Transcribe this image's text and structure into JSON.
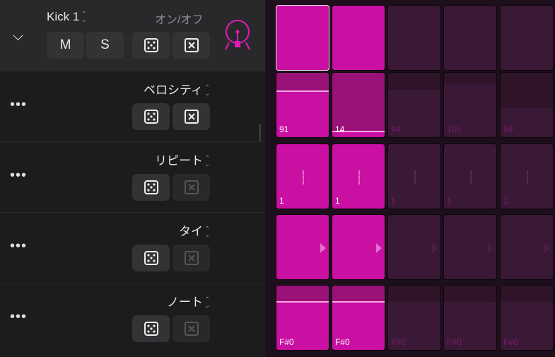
{
  "track": {
    "name": "Kick 1",
    "onoff_label": "オン/オフ",
    "mute_label": "M",
    "solo_label": "S",
    "icon": "drum-kit-icon"
  },
  "rows": [
    {
      "label": "ベロシティ",
      "clear_enabled": true
    },
    {
      "label": "リピート",
      "clear_enabled": false
    },
    {
      "label": "タイ",
      "clear_enabled": false
    },
    {
      "label": "ノート",
      "clear_enabled": false
    }
  ],
  "colors": {
    "active": "#c910a2",
    "active_dim": "#9a1277",
    "inactive": "#3a1936",
    "inactive_dim": "#2f1429",
    "accent": "#e01bb8"
  },
  "grid": {
    "onoff": [
      true,
      true,
      false,
      false,
      false
    ],
    "velocity": [
      91,
      14,
      94,
      106,
      59
    ],
    "repeat": [
      "1",
      "1",
      "1",
      "1",
      "1"
    ],
    "tie": [
      true,
      true,
      false,
      false,
      false
    ],
    "note": [
      "F#0",
      "F#0",
      "F#0",
      "F#0",
      "F#0"
    ],
    "note_level": 0.75
  }
}
